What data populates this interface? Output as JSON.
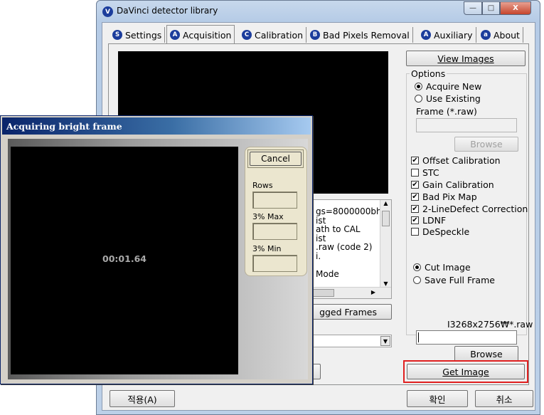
{
  "main_window": {
    "title": "DaVinci detector library",
    "icon_letter": "V",
    "caption": {
      "minimize": "—",
      "maximize": "□",
      "close": "X"
    }
  },
  "tabs": [
    {
      "label": "Settings",
      "icon": "S"
    },
    {
      "label": "Acquisition",
      "icon": "A"
    },
    {
      "label": "Calibration",
      "icon": "C"
    },
    {
      "label": "Bad Pixels Removal",
      "icon": "B"
    },
    {
      "label": "Auxiliary",
      "icon": "A"
    },
    {
      "label": "About",
      "icon": "a"
    }
  ],
  "acquisition": {
    "view_images_label": "View Images",
    "options_label": "Options",
    "acquire_new_label": "Acquire New",
    "use_existing_label": "Use Existing",
    "frame_label": "Frame (*.raw)",
    "frame_value": "",
    "browse_disabled_label": "Browse",
    "checkboxes": [
      {
        "label": "Offset Calibration",
        "checked": true
      },
      {
        "label": "STC",
        "checked": false
      },
      {
        "label": "Gain Calibration",
        "checked": true
      },
      {
        "label": "Bad Pix Map",
        "checked": true
      },
      {
        "label": "2-LineDefect Correction",
        "checked": true
      },
      {
        "label": "LDNF",
        "checked": true
      },
      {
        "label": "DeSpeckle",
        "checked": false
      }
    ],
    "cut_image_label": "Cut Image",
    "save_full_frame_label": "Save Full Frame",
    "file_pattern": "I3268x2756₩*.raw",
    "save_field_value": "",
    "browse_label": "Browse",
    "get_image_label": "Get Image",
    "log_lines": [
      "gs=8000000bh (",
      "ist",
      "ath to CAL",
      "ist",
      ".raw (code 2)",
      "i.",
      "",
      "Mode"
    ],
    "flagged_frames_label": "gged Frames",
    "dropdown_value": ""
  },
  "bottom_buttons": {
    "apply_label": "적용(A)",
    "ok_label": "확인",
    "cancel_label": "취소"
  },
  "dialog": {
    "title": "Acquiring bright frame",
    "timer": "00:01.64",
    "cancel_label": "Cancel",
    "rows_label": "Rows",
    "max_label": "3% Max",
    "min_label": "3% Min"
  }
}
